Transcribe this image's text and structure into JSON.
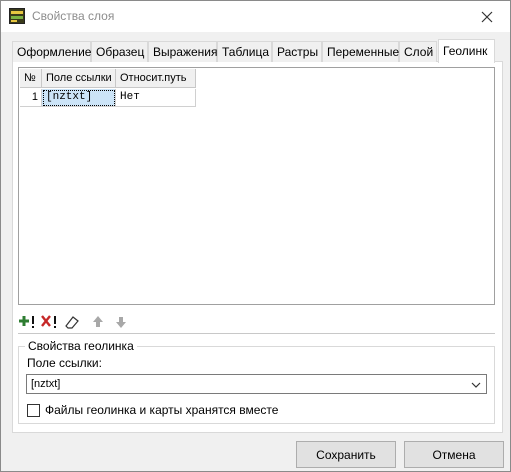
{
  "window": {
    "title": "Свойства слоя"
  },
  "tabs": [
    {
      "label": "Оформление"
    },
    {
      "label": "Образец"
    },
    {
      "label": "Выражения"
    },
    {
      "label": "Таблица"
    },
    {
      "label": "Растры"
    },
    {
      "label": "Переменные"
    },
    {
      "label": "Слой"
    },
    {
      "label": "Геолинк",
      "active": true
    }
  ],
  "grid": {
    "columns": [
      "№",
      "Поле ссылки",
      "Относит.путь"
    ],
    "rows": [
      {
        "num": "1",
        "link_field": "[nztxt]",
        "relative_path": "Нет"
      }
    ]
  },
  "toolbar": {
    "icons": [
      "add-row-icon",
      "delete-row-icon",
      "clear-icon",
      "move-up-icon",
      "move-down-icon"
    ]
  },
  "group": {
    "title": "Свойства геолинка",
    "field_label": "Поле ссылки:",
    "field_value": "[nztxt]",
    "checkbox_label": "Файлы геолинка и карты хранятся вместе",
    "checkbox_checked": false
  },
  "buttons": {
    "save": "Сохранить",
    "cancel": "Отмена"
  }
}
